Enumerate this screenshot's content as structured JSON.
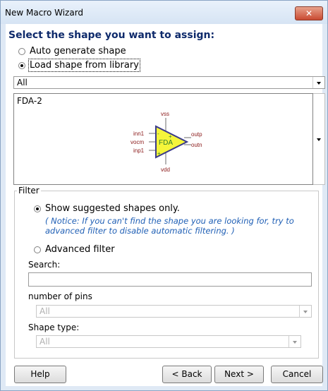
{
  "window": {
    "title": "New Macro Wizard",
    "close_label": "✕"
  },
  "heading": "Select the shape you want to assign:",
  "options": {
    "auto_generate": "Auto generate shape",
    "load_library": "Load shape from library"
  },
  "library_combo": {
    "value": "All"
  },
  "shape_preview": {
    "name": "FDA-2",
    "symbol_label": "FDA",
    "pins": {
      "top": "vss",
      "bottom": "vdd",
      "left": [
        "inn1",
        "vocm",
        "inp1"
      ],
      "right": [
        "outp",
        "outn"
      ]
    }
  },
  "filter": {
    "group_label": "Filter",
    "suggested_label": "Show suggested shapes only.",
    "notice": "( Notice: If you can't find the shape you are looking for, try to advanced filter to disable automatic filtering. )",
    "advanced_label": "Advanced filter",
    "search_label": "Search:",
    "search_value": "",
    "pins_label": "number of pins",
    "pins_value": "All",
    "shape_type_label": "Shape type:",
    "shape_type_value": "All"
  },
  "buttons": {
    "help": "Help",
    "back": "< Back",
    "next": "Next >",
    "cancel": "Cancel"
  },
  "colors": {
    "heading": "#0e2a6b",
    "notice": "#1f5fb5",
    "triangle_fill": "#f5f53b",
    "pin_label": "#8b1a1a",
    "symbol_text": "#2e7d2e"
  }
}
